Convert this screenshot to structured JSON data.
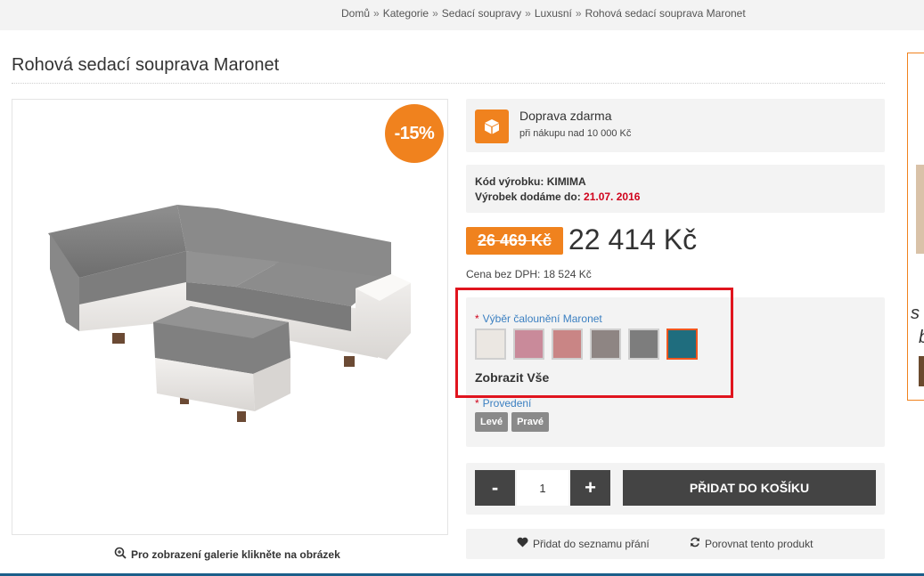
{
  "breadcrumb": {
    "items": [
      "Domů",
      "Kategorie",
      "Sedací soupravy",
      "Luxusní",
      "Rohová sedací souprava Maronet"
    ],
    "separator": "»"
  },
  "product": {
    "title": "Rohová sedací souprava Maronet",
    "discount_badge": "-15%",
    "gallery_hint": "Pro zobrazení galerie klikněte na obrázek"
  },
  "shipping": {
    "title": "Doprava zdarma",
    "subtitle": "při nákupu nad 10 000 Kč",
    "icon": "box-icon"
  },
  "codes": {
    "code_label": "Kód výrobku:",
    "code_value": "KIMIMA",
    "delivery_label": "Výrobek dodáme do:",
    "delivery_value": "21.07. 2016"
  },
  "price": {
    "old": "26 469 Kč",
    "new": "22 414 Kč",
    "vat_label": "Cena bez DPH:",
    "vat_value": "18 524 Kč"
  },
  "options": {
    "upholstery_label": "Výběr čalounění Maronet",
    "swatches": [
      {
        "color": "#ebe7e2",
        "selected": false
      },
      {
        "color": "#c98a9a",
        "selected": false
      },
      {
        "color": "#c98585",
        "selected": false
      },
      {
        "color": "#8e8583",
        "selected": false
      },
      {
        "color": "#7d7d7d",
        "selected": false
      },
      {
        "color": "#1f6d7e",
        "selected": true
      }
    ],
    "show_all": "Zobrazit Vše",
    "variant_label": "Provedení",
    "variants": [
      "Levé",
      "Pravé"
    ],
    "required_mark": "*"
  },
  "cart": {
    "minus": "-",
    "plus": "+",
    "quantity": "1",
    "add_label": "PŘIDAT DO KOŠÍKU"
  },
  "actions": {
    "wishlist": "Přidat do seznamu přání",
    "compare": "Porovnat tento produkt"
  },
  "side": {
    "text1": "s",
    "text2": "b"
  },
  "colors": {
    "accent": "#f0821e",
    "dark_button": "#444444",
    "highlight": "#e0141e",
    "link": "#3a7fc1",
    "date": "#d0021b"
  }
}
